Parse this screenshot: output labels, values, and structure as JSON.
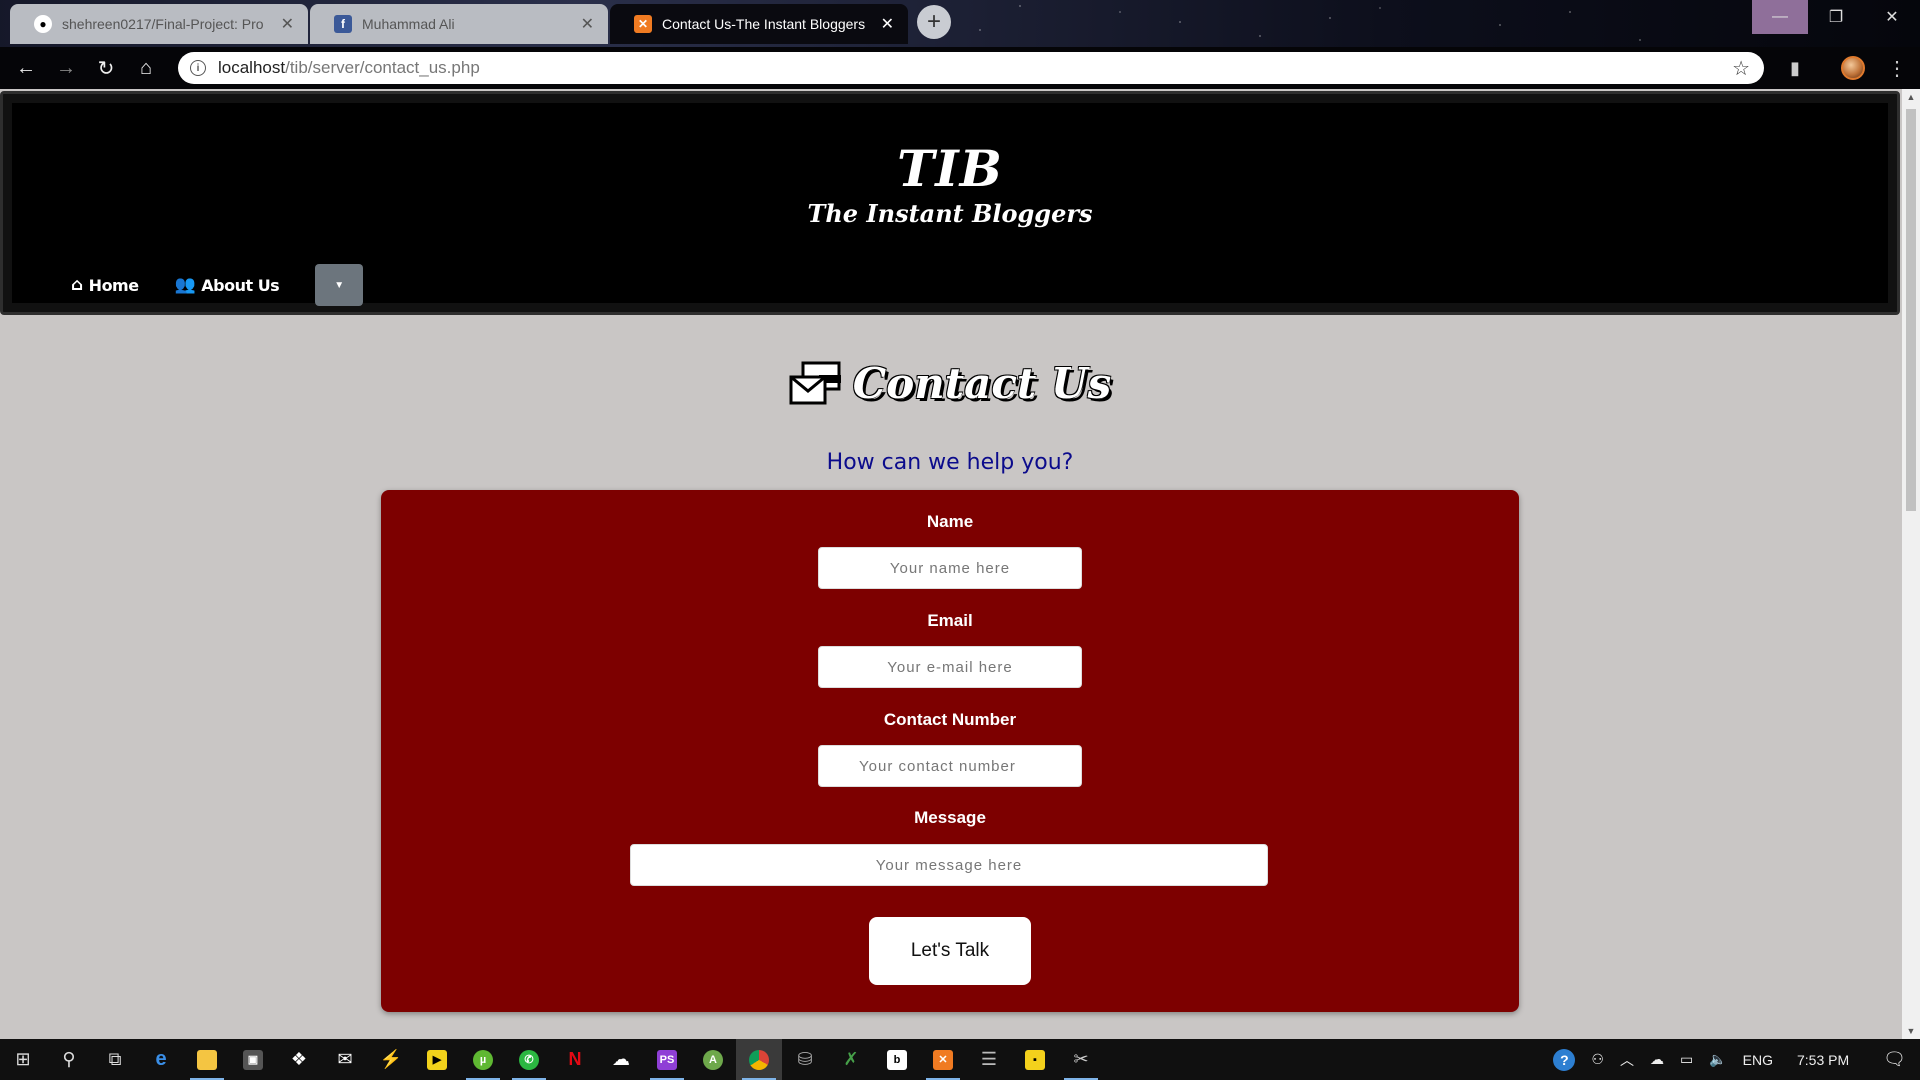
{
  "browser": {
    "tabs": [
      {
        "title": "shehreen0217/Final-Project: Pro",
        "favicon": "github-icon"
      },
      {
        "title": "Muhammad Ali",
        "favicon": "facebook-icon"
      },
      {
        "title": "Contact Us-The Instant Bloggers",
        "favicon": "xampp-icon"
      }
    ],
    "url_host": "localhost",
    "url_path": "/tib/server/contact_us.php"
  },
  "site": {
    "brand": "TIB",
    "tagline": "The Instant Bloggers",
    "nav": [
      {
        "label": "Home",
        "icon": "home-icon"
      },
      {
        "label": "About Us",
        "icon": "users-icon"
      }
    ]
  },
  "contact": {
    "title": "Contact Us",
    "subtitle": "How can we help you?",
    "fields": {
      "name": {
        "label": "Name",
        "placeholder": "Your name here"
      },
      "email": {
        "label": "Email",
        "placeholder": "Your e-mail here"
      },
      "phone": {
        "label": "Contact Number",
        "placeholder": "Your contact number"
      },
      "message": {
        "label": "Message",
        "placeholder": "Your message here"
      }
    },
    "submit": "Let's Talk"
  },
  "taskbar": {
    "language": "ENG",
    "time": "7:53 PM"
  },
  "colors": {
    "card": "#7d0000",
    "page_bg": "#c9c6c5",
    "header_bg": "#000000",
    "subtitle": "#0b0b8c",
    "dropdown": "#6c757d"
  }
}
